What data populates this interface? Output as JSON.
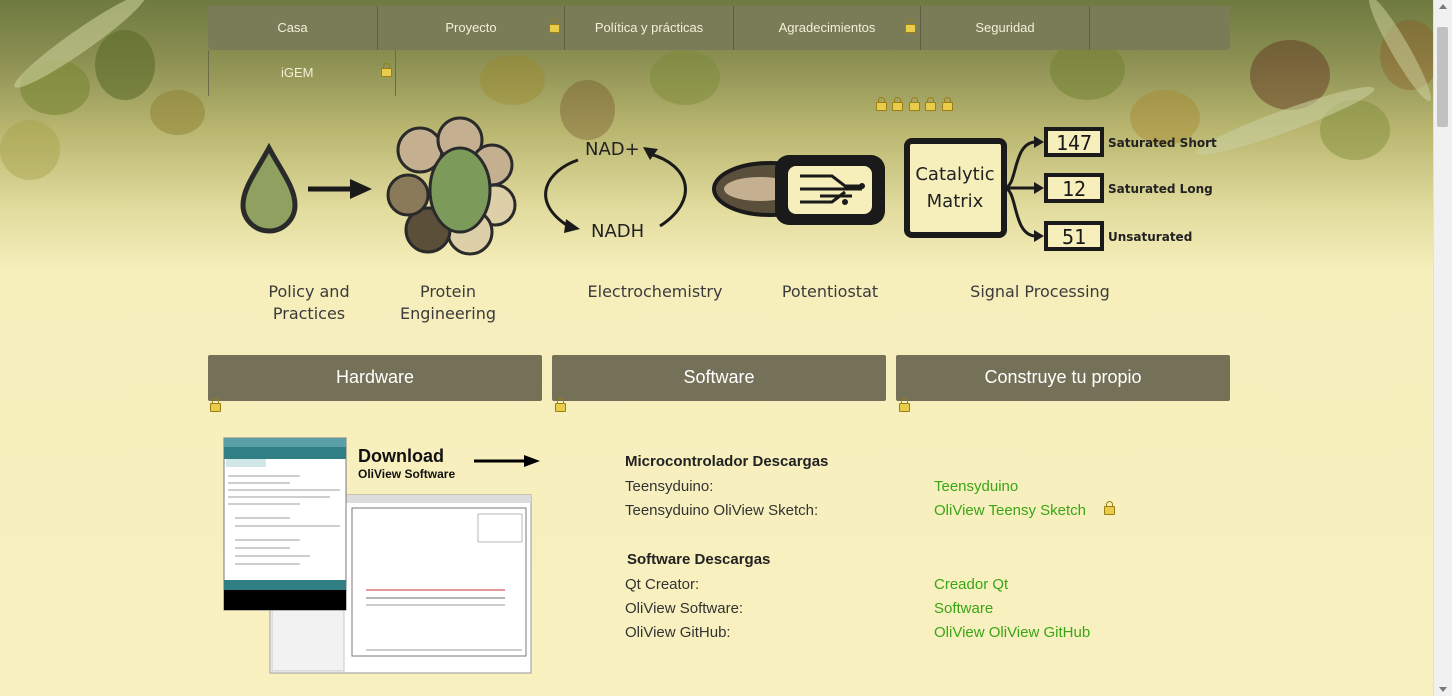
{
  "nav": {
    "items": [
      {
        "label": "Casa"
      },
      {
        "label": "Proyecto"
      },
      {
        "label": "Política y prácticas"
      },
      {
        "label": "Agradecimientos"
      },
      {
        "label": "Seguridad"
      }
    ],
    "sub_item": "iGEM"
  },
  "pipeline": {
    "stages": [
      "Policy and Practices",
      "Protein Engineering",
      "Electrochemistry",
      "Potentiostat",
      "Signal Processing"
    ],
    "nad_plus": "NAD+",
    "nadh": "NADH",
    "matrix_line1": "Catalytic",
    "matrix_line2": "Matrix",
    "outputs": [
      {
        "value": "147",
        "label": "Saturated Short"
      },
      {
        "value": "12",
        "label": "Saturated Long"
      },
      {
        "value": "51",
        "label": "Unsaturated"
      }
    ]
  },
  "sections": {
    "hardware": "Hardware",
    "software": "Software",
    "build": "Construye tu propio"
  },
  "download": {
    "title": "Download",
    "subtitle": "OliView Software"
  },
  "micro": {
    "heading": "Microcontrolador Descargas",
    "rows": [
      {
        "label": "Teensyduino:",
        "link": "Teensyduino"
      },
      {
        "label": "Teensyduino OliView Sketch:",
        "link": "OliView Teensy Sketch"
      }
    ]
  },
  "software_dl": {
    "heading": "Software Descargas",
    "rows": [
      {
        "label": "Qt Creator:",
        "link": "Creador Qt"
      },
      {
        "label": "OliView Software:",
        "link": "Software"
      },
      {
        "label": "OliView GitHub:",
        "link": "OliView OliView GitHub"
      }
    ]
  },
  "colors": {
    "nav_bg": "#7a7c58",
    "section_bg": "#747158",
    "link": "#3aa516",
    "page_bg": "#f6eebb"
  }
}
